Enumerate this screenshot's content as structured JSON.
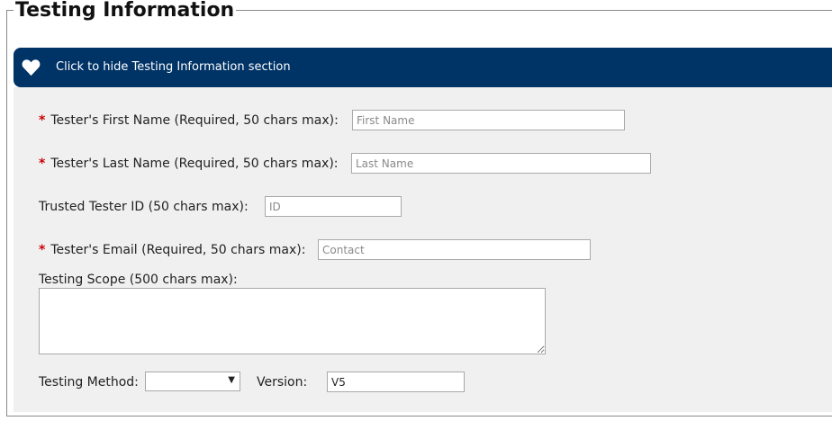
{
  "section": {
    "title": "Testing Information",
    "toggle_label": "Click to hide Testing Information section"
  },
  "fields": {
    "first_name": {
      "required_mark": "*",
      "label": "Tester's First Name (Required, 50 chars max):",
      "placeholder": "First Name",
      "value": ""
    },
    "last_name": {
      "required_mark": "*",
      "label": "Tester's Last Name (Required, 50 chars max):",
      "placeholder": "Last Name",
      "value": ""
    },
    "tester_id": {
      "label": "Trusted Tester ID (50 chars max):",
      "placeholder": "ID",
      "value": ""
    },
    "email": {
      "required_mark": "*",
      "label": "Tester's Email (Required, 50 chars max):",
      "placeholder": "Contact",
      "value": ""
    },
    "scope": {
      "label": "Testing Scope (500 chars max):",
      "value": ""
    },
    "method": {
      "label": "Testing Method:",
      "selected": ""
    },
    "version": {
      "label": "Version:",
      "value": "V5"
    }
  },
  "colors": {
    "section_bar": "#003366",
    "required": "#cc0000",
    "panel_bg": "#f0f0f0"
  }
}
